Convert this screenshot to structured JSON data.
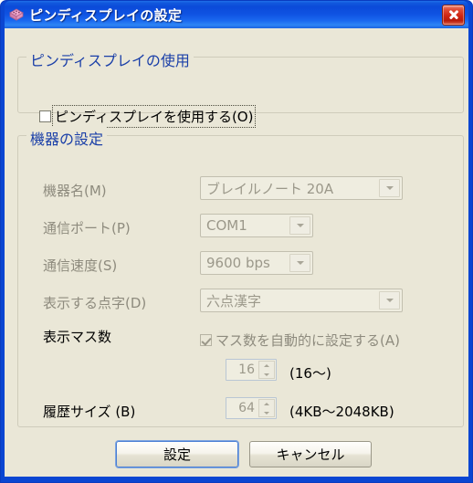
{
  "window": {
    "title": "ピンディスプレイの設定",
    "icon": "braille-display-icon",
    "close_label": "×",
    "accent_blue": "#0A46D2",
    "client_bg": "#EAE7D7",
    "group_label_color": "#1A3FA8",
    "disabled_text_color": "#9B988A"
  },
  "use_group": {
    "title": "ピンディスプレイの使用",
    "checkbox": {
      "label": "ピンディスプレイを使用する(O)",
      "mnemonic": "O",
      "checked": false,
      "focused": true
    }
  },
  "device_group": {
    "title": "機器の設定",
    "rows": [
      {
        "label": "機器名(M)",
        "mnemonic": "M",
        "control": "combo",
        "value": "ブレイルノート 20A",
        "disabled": true
      },
      {
        "label": "通信ポート(P)",
        "mnemonic": "P",
        "control": "combo",
        "value": "COM1",
        "disabled": true
      },
      {
        "label": "通信速度(S)",
        "mnemonic": "S",
        "control": "combo",
        "value": "9600 bps",
        "disabled": true
      },
      {
        "label": "表示する点字(D)",
        "mnemonic": "D",
        "control": "combo",
        "value": "六点漢字",
        "disabled": true
      }
    ],
    "cells_row": {
      "label": "表示マス数",
      "auto_checkbox": {
        "label": "マス数を自動的に設定する(A)",
        "mnemonic": "A",
        "checked": true,
        "disabled": true
      },
      "spinner": {
        "value": "16",
        "range_hint": "(16〜)",
        "disabled": true
      }
    },
    "history_row": {
      "label": "履歴サイズ (B)",
      "mnemonic": "B",
      "spinner": {
        "value": "64",
        "range_hint": "(4KB〜2048KB)",
        "disabled": true
      }
    }
  },
  "buttons": {
    "ok": "設定",
    "cancel": "キャンセル"
  }
}
